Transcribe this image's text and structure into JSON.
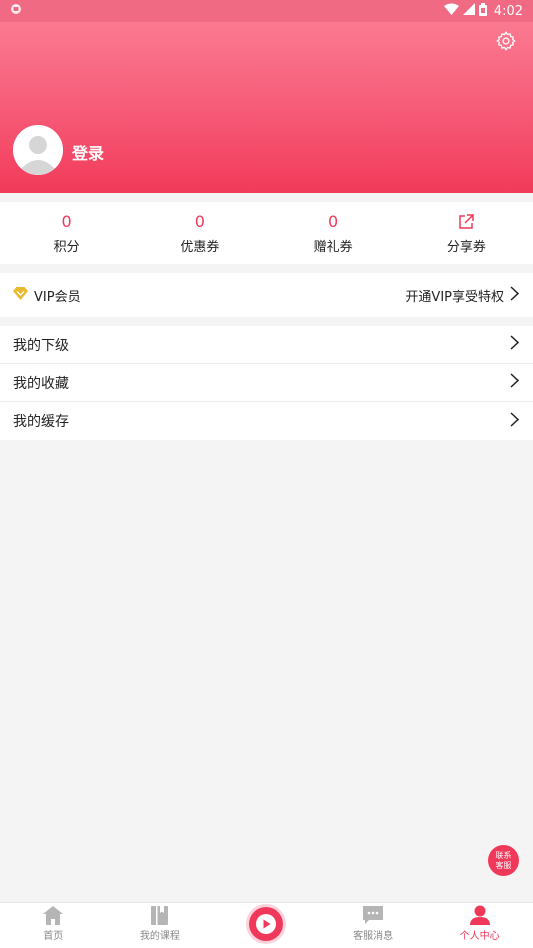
{
  "status_bar": {
    "time": "4:02"
  },
  "header": {
    "login_label": "登录"
  },
  "stats": [
    {
      "value": "0",
      "label": "积分"
    },
    {
      "value": "0",
      "label": "优惠券"
    },
    {
      "value": "0",
      "label": "赠礼券"
    },
    {
      "label": "分享券",
      "icon": "share-icon"
    }
  ],
  "vip": {
    "label": "VIP会员",
    "action": "开通VIP享受特权"
  },
  "menu": [
    {
      "label": "我的下级"
    },
    {
      "label": "我的收藏"
    },
    {
      "label": "我的缓存"
    }
  ],
  "float_service": {
    "line1": "联系",
    "line2": "客服"
  },
  "tabs": [
    {
      "label": "首页",
      "icon": "home-icon"
    },
    {
      "label": "我的课程",
      "icon": "book-icon"
    },
    {
      "label": "",
      "icon": "play-icon"
    },
    {
      "label": "客服消息",
      "icon": "message-icon"
    },
    {
      "label": "个人中心",
      "icon": "person-icon"
    }
  ],
  "colors": {
    "accent": "#f0395a",
    "header_top": "#fb7a90",
    "header_bottom": "#f23a5a"
  }
}
